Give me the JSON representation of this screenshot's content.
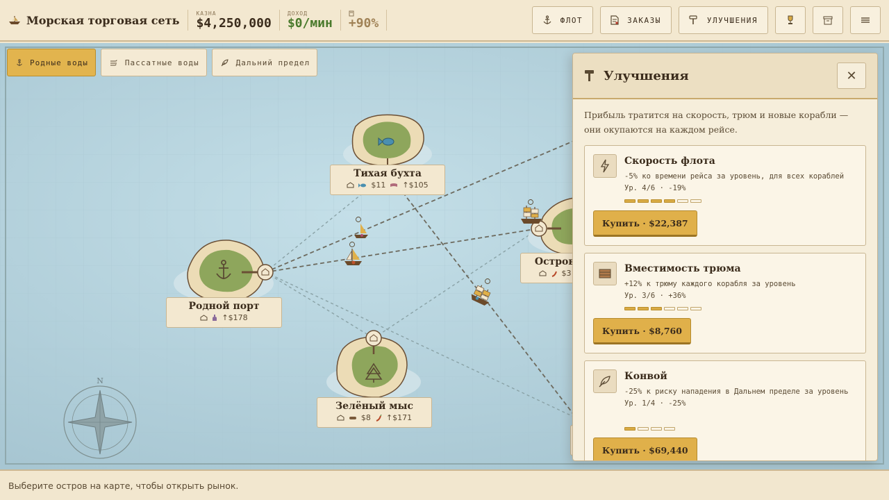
{
  "header": {
    "title": "Морская торговая сеть",
    "treasury_label": "КАЗНА",
    "treasury_value": "$4,250,000",
    "income_label": "ДОХОД",
    "income_value": "$0/мин",
    "bonus_value": "+90%"
  },
  "top_buttons": {
    "fleet": "ФЛОТ",
    "orders": "ЗАКАЗЫ",
    "upgrades": "УЛУЧШЕНИЯ"
  },
  "regions": [
    {
      "label": "Родные воды",
      "active": true
    },
    {
      "label": "Пассатные воды",
      "active": false
    },
    {
      "label": "Дальний предел",
      "active": false
    }
  ],
  "islands": [
    {
      "name": "Тихая бухта",
      "price": "$11",
      "profit": "↑$105",
      "icon": "fish-icon"
    },
    {
      "name": "Родной порт",
      "price": "",
      "profit": "↑$178",
      "icon": "anchor-icon"
    },
    {
      "name": "Зелёный мыс",
      "price": "$8",
      "price2": "",
      "profit": "↑$171",
      "icon": "tree-icon"
    },
    {
      "name": "Остров",
      "price": "$3",
      "icon": "unknown"
    }
  ],
  "compass": {
    "north": "N"
  },
  "panel": {
    "title": "Улучшения",
    "close": "✕",
    "description": "Прибыль тратится на скорость, трюм и новые корабли — они окупаются на каждом рейсе.",
    "cards": [
      {
        "title": "Скорость флота",
        "desc": "-5% ко времени рейса за уровень, для всех кораблей",
        "level": "Ур. 4/6 · -19%",
        "level_current": 4,
        "level_max": 6,
        "buy": "Купить · $22,387",
        "icon": "lightning-icon"
      },
      {
        "title": "Вместимость трюма",
        "desc": "+12% к трюму каждого корабля за уровень",
        "level": "Ур. 3/6 · +36%",
        "level_current": 3,
        "level_max": 6,
        "buy": "Купить · $8,760",
        "icon": "crate-icon"
      },
      {
        "title": "Конвой",
        "desc": "-25% к риску нападения в Дальнем пределе за уровень",
        "level": "Ур. 1/4 · -25%",
        "level_current": 1,
        "level_max": 4,
        "buy": "Купить · $69,440",
        "icon": "feather-icon"
      }
    ]
  },
  "status": "Выберите остров на карте, чтобы открыть рынок.",
  "colors": {
    "accent": "#e2b44e",
    "income": "#4a7a2c",
    "sea": "#b9d6e0",
    "parchment": "#f3e8d0"
  }
}
